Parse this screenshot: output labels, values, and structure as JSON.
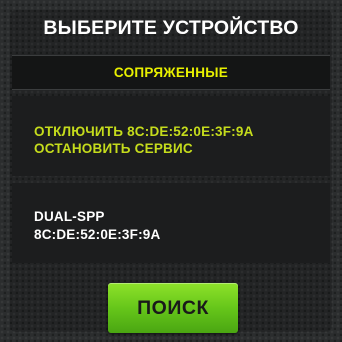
{
  "header": {
    "title": "ВЫБЕРИТЕ УСТРОЙСТВО"
  },
  "paired_section": {
    "label": "СОПРЯЖЕННЫЕ"
  },
  "actions": {
    "disconnect": "ОТКЛЮЧИТЬ 8C:DE:52:0E:3F:9A",
    "stop_service": "ОСТАНОВИТЬ СЕРВИС"
  },
  "devices": [
    {
      "name": "DUAL-SPP",
      "address": "8C:DE:52:0E:3F:9A"
    }
  ],
  "footer": {
    "search_label": "ПОИСК"
  },
  "colors": {
    "background": "#2b2d2e",
    "panel": "#1c1d1e",
    "section_header_text": "#e8f000",
    "action_text": "#c5dc1c",
    "button_green": "#66c61a"
  }
}
